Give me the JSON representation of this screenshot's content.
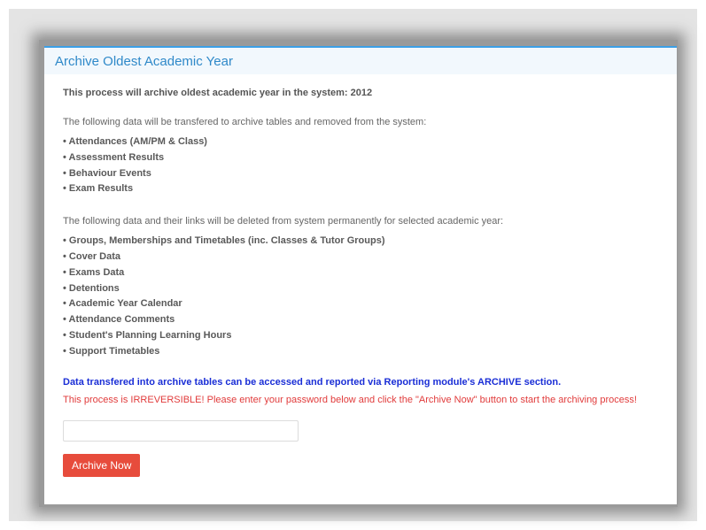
{
  "panel": {
    "title": "Archive Oldest Academic Year",
    "intro": "This process will archive oldest academic year in the system: 2012",
    "archive_intro": "The following data will be transfered to archive tables and removed from the system:",
    "archive_items": [
      "Attendances (AM/PM & Class)",
      "Assessment Results",
      "Behaviour Events",
      "Exam Results"
    ],
    "delete_intro": "The following data and their links will be deleted from system permanently for selected academic year:",
    "delete_items": [
      "Groups, Memberships and Timetables (inc. Classes & Tutor Groups)",
      "Cover Data",
      "Exams Data",
      "Detentions",
      "Academic Year Calendar",
      "Attendance Comments",
      "Student's Planning Learning Hours",
      "Support Timetables"
    ],
    "note_info": "Data transfered into archive tables can be accessed and reported via Reporting module's ARCHIVE section.",
    "note_warning": "This process is IRREVERSIBLE! Please enter your password below and click the \"Archive Now\" button to start the archiving process!",
    "password_value": "",
    "button_label": "Archive Now"
  },
  "colors": {
    "header_text": "#2f89c9",
    "header_border": "#3c9fe6",
    "info_text": "#1a2ed6",
    "warning_text": "#e13b3b",
    "button_bg": "#e74c3c"
  }
}
